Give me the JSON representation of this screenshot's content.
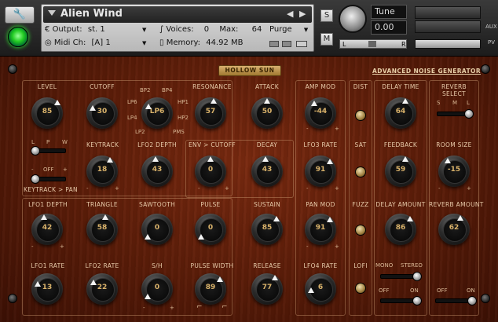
{
  "header": {
    "title": "Alien Wind",
    "output_label": "Output:",
    "output_value": "st. 1",
    "midi_label": "Midi Ch:",
    "midi_value": "[A] 1",
    "voices_label": "Voices:",
    "voices_value": "0",
    "max_label": "Max:",
    "max_value": "64",
    "memory_label": "Memory:",
    "memory_value": "44.92 MB",
    "purge_label": "Purge",
    "s_label": "S",
    "m_label": "M",
    "tune_label": "Tune",
    "tune_value": "0.00",
    "pan_l": "L",
    "pan_r": "R",
    "aux_label": "AUX",
    "pv_label": "PV"
  },
  "panel": {
    "badge": "HOLLOW SUN",
    "subtitle": "ADVANCED NOISE GENERATOR",
    "labels": {
      "level": "LEVEL",
      "cutoff": "CUTOFF",
      "resonance": "RESONANCE",
      "attack": "ATTACK",
      "amp_mod": "AMP MOD",
      "dist": "DIST",
      "delay_time": "DELAY TIME",
      "reverb_select": "REVERB",
      "reverb_select2": "SELECT",
      "keytrack": "KEYTRACK",
      "lfo2_depth": "LFO2 DEPTH",
      "env_cutoff": "ENV > CUTOFF",
      "decay": "DECAY",
      "lfo3_rate": "LFO3 RATE",
      "sat": "SAT",
      "feedback": "FEEDBACK",
      "room_size": "ROOM SIZE",
      "lfo1_depth": "LFO1 DEPTH",
      "triangle": "TRIANGLE",
      "sawtooth": "SAWTOOTH",
      "pulse": "PULSE",
      "sustain": "SUSTAIN",
      "pan_mod": "PAN MOD",
      "fuzz": "FUZZ",
      "delay_amount": "DELAY AMOUNT",
      "reverb_amount": "REVERB AMOUNT",
      "lfo1_rate": "LFO1 RATE",
      "lfo2_rate": "LFO2 RATE",
      "sh": "S/H",
      "pulse_width": "PULSE WIDTH",
      "release": "RELEASE",
      "lfo4_rate": "LFO4 RATE",
      "lofi": "LOFI",
      "mono": "MONO",
      "stereo": "STEREO",
      "off": "OFF",
      "on": "ON",
      "off2": "OFF",
      "on2": "ON",
      "lpw_l": "L",
      "lpw_p": "P",
      "lpw_w": "W",
      "kt_off": "OFF",
      "keytrack_pan": "KEYTRACK > PAN",
      "bp2": "BP2",
      "bp4": "BP4",
      "lp6": "LP6",
      "hp1": "HP1",
      "lp4": "LP4",
      "hp2": "HP2",
      "lp2": "LP2",
      "pms": "PMS",
      "rs_s": "S",
      "rs_m": "M",
      "rs_l": "L",
      "minus": "-",
      "plus": "+"
    },
    "knobs": {
      "level": "85",
      "cutoff": "30",
      "filter_type": "LP6",
      "resonance": "57",
      "attack": "50",
      "amp_mod": "-44",
      "delay_time": "64",
      "keytrack": "18",
      "lfo2_depth": "43",
      "env_cutoff": "0",
      "decay": "43",
      "lfo3_rate": "91",
      "feedback": "59",
      "room_size": "-15",
      "lfo1_depth": "42",
      "triangle": "58",
      "sawtooth": "0",
      "pulse": "0",
      "sustain": "85",
      "pan_mod": "91",
      "delay_amount": "86",
      "reverb_amount": "62",
      "lfo1_rate": "13",
      "lfo2_rate": "22",
      "sh": "0",
      "pulse_width": "89",
      "release": "77",
      "lfo4_rate": "6"
    }
  }
}
